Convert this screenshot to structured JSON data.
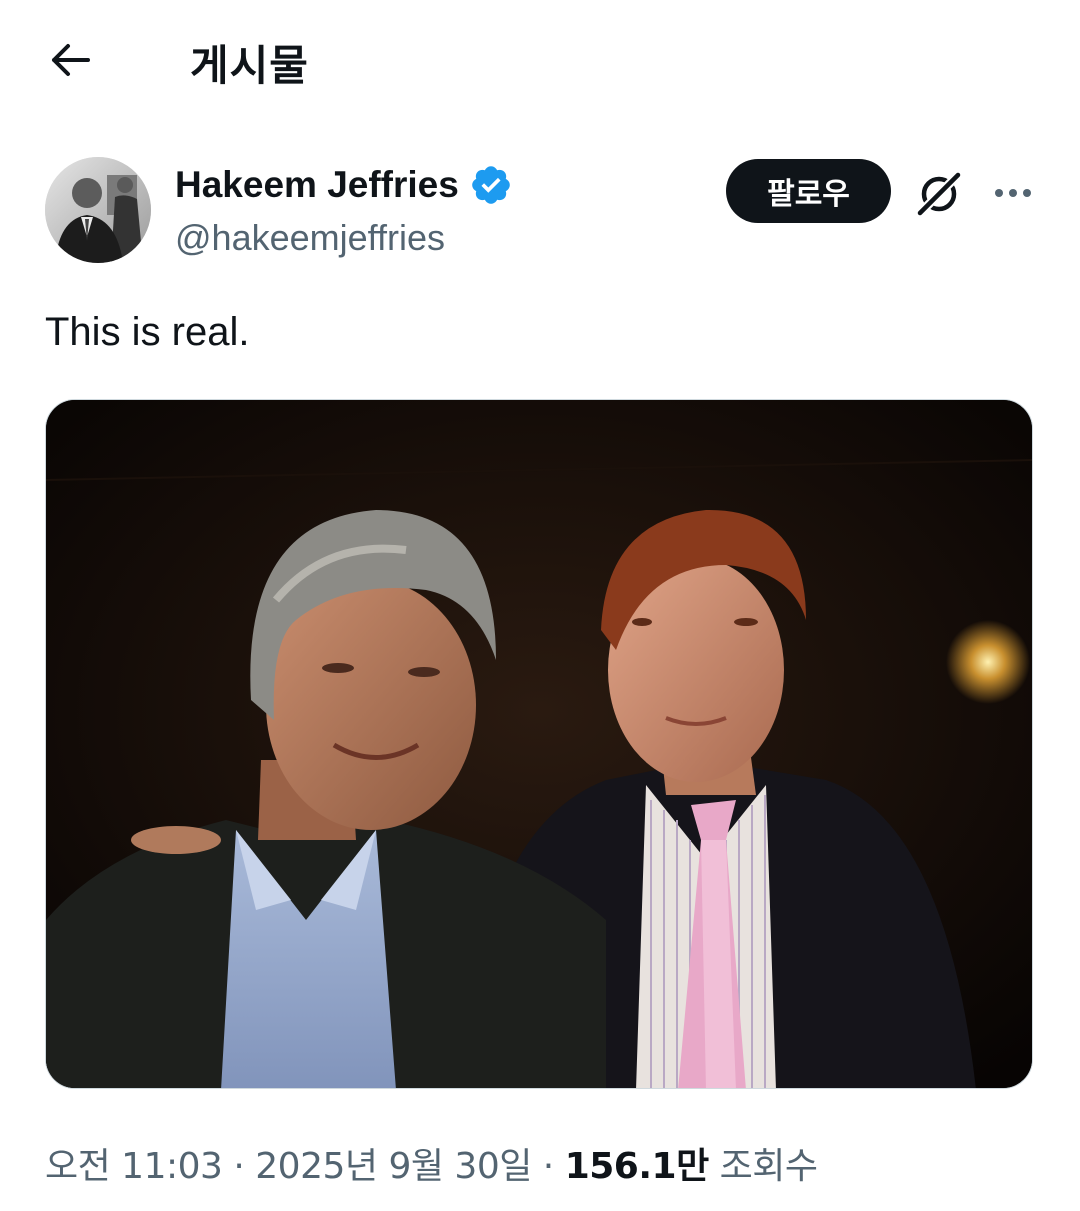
{
  "header": {
    "title": "게시물",
    "back_icon": "arrow-left-icon"
  },
  "author": {
    "display_name": "Hakeem Jeffries",
    "handle": "@hakeemjeffries",
    "verified": true,
    "verified_color": "#1d9bf0",
    "follow_label": "팔로우"
  },
  "tweet": {
    "text": "This is real."
  },
  "meta": {
    "time": "오전 11:03",
    "date": "2025년 9월 30일",
    "separator": " · ",
    "views_count": "156.1만",
    "views_label": "조회수"
  },
  "colors": {
    "text_primary": "#0f1419",
    "text_secondary": "#536471",
    "follow_bg": "#0f1419",
    "follow_text": "#ffffff"
  }
}
